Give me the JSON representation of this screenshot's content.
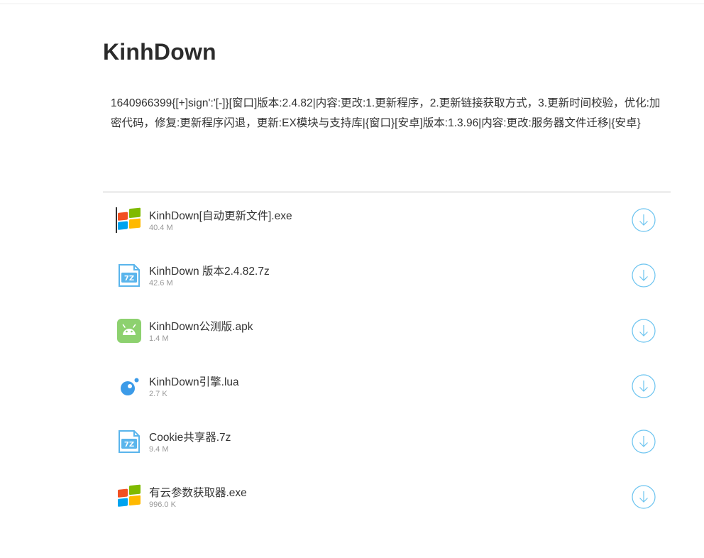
{
  "page": {
    "title": "KinhDown",
    "description": "1640966399{[+]sign':'[-]}[窗口]版本:2.4.82|内容:更改:1.更新程序，2.更新链接获取方式，3.更新时间校验，优化:加密代码，修复:更新程序闪退，更新:EX模块与支持库|{窗口}[安卓]版本:1.3.96|内容:更改:服务器文件迁移|{安卓}"
  },
  "files": [
    {
      "name": "KinhDown[自动更新文件].exe",
      "size": "40.4 M",
      "icon": "windows-icon"
    },
    {
      "name": "KinhDown 版本2.4.82.7z",
      "size": "42.6 M",
      "icon": "7z-archive-icon"
    },
    {
      "name": "KinhDown公测版.apk",
      "size": "1.4 M",
      "icon": "android-icon"
    },
    {
      "name": "KinhDown引擎.lua",
      "size": "2.7 K",
      "icon": "lua-icon"
    },
    {
      "name": "Cookie共享器.7z",
      "size": "9.4 M",
      "icon": "7z-archive-icon"
    },
    {
      "name": "有云参数获取器.exe",
      "size": "996.0 K",
      "icon": "windows-icon"
    }
  ],
  "colors": {
    "accent": "#6cc4f0",
    "win_red": "#f25022",
    "win_green": "#7fba00",
    "win_blue": "#00a4ef",
    "win_yellow": "#ffb900",
    "android_green": "#8dd16f",
    "archive_blue": "#5ab5ec",
    "lua_blue": "#3c9be8"
  }
}
